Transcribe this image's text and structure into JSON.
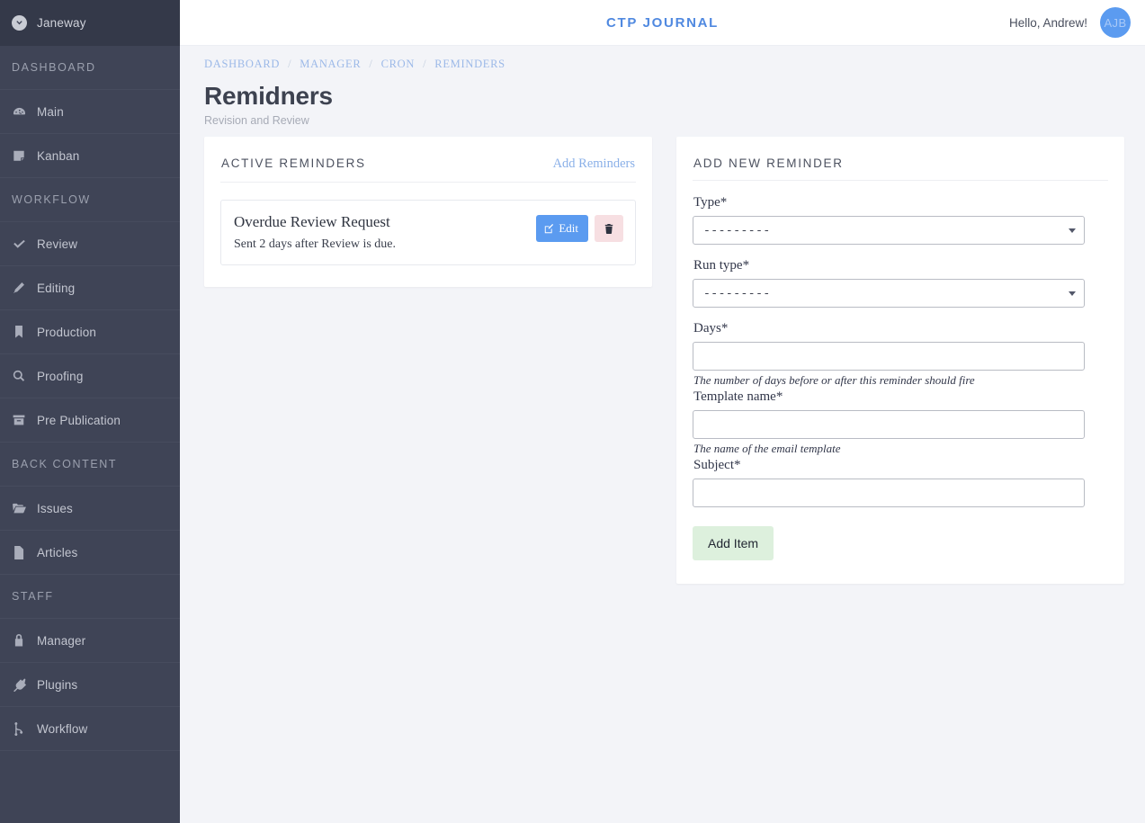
{
  "sidebar": {
    "brand": {
      "name": "Janeway",
      "icon": "chevron-circle-down-icon"
    },
    "groups": [
      {
        "section": "DASHBOARD",
        "items": [
          {
            "label": "Main",
            "icon": "tachometer-icon"
          },
          {
            "label": "Kanban",
            "icon": "sticky-note-icon"
          }
        ]
      },
      {
        "section": "WORKFLOW",
        "items": [
          {
            "label": "Review",
            "icon": "check-icon"
          },
          {
            "label": "Editing",
            "icon": "pencil-icon"
          },
          {
            "label": "Production",
            "icon": "bookmark-icon"
          },
          {
            "label": "Proofing",
            "icon": "search-icon"
          },
          {
            "label": "Pre Publication",
            "icon": "archive-icon"
          }
        ]
      },
      {
        "section": "BACK CONTENT",
        "items": [
          {
            "label": "Issues",
            "icon": "folder-open-icon"
          },
          {
            "label": "Articles",
            "icon": "file-icon"
          }
        ]
      },
      {
        "section": "STAFF",
        "items": [
          {
            "label": "Manager",
            "icon": "lock-icon"
          },
          {
            "label": "Plugins",
            "icon": "plug-icon"
          },
          {
            "label": "Workflow",
            "icon": "code-fork-icon"
          }
        ]
      }
    ]
  },
  "topbar": {
    "title": "CTP JOURNAL",
    "greeting": "Hello, Andrew!",
    "avatar_initials": "AJB"
  },
  "breadcrumb": {
    "items": [
      "DASHBOARD",
      "MANAGER",
      "CRON",
      "REMINDERS"
    ],
    "separator": "/"
  },
  "page": {
    "title": "Remidners",
    "subtitle": "Revision and Review"
  },
  "active_reminders": {
    "title": "ACTIVE REMINDERS",
    "action_label": "Add Reminders",
    "items": [
      {
        "name": "Overdue Review Request",
        "description": "Sent 2 days after Review is due.",
        "edit_label": "Edit",
        "edit_icon": "pencil-square-icon",
        "delete_icon": "trash-icon"
      }
    ]
  },
  "add_reminder": {
    "title": "ADD NEW REMINDER",
    "fields": {
      "type": {
        "label": "Type*",
        "value": "---------"
      },
      "run_type": {
        "label": "Run type*",
        "value": "---------"
      },
      "days": {
        "label": "Days*",
        "value": "",
        "help": "The number of days before or after this reminder should fire"
      },
      "template_name": {
        "label": "Template name*",
        "value": "",
        "help": "The name of the email template"
      },
      "subject": {
        "label": "Subject*",
        "value": ""
      }
    },
    "submit_label": "Add Item"
  },
  "colors": {
    "sidebar_bg": "#3f4456",
    "brand_bg": "#343949",
    "page_bg": "#f3f4f8",
    "accent_blue": "#5b9bf0",
    "link_blue": "#9cb9e8",
    "delete_bg": "#f7dfe2",
    "submit_bg": "#ddf0dd"
  }
}
